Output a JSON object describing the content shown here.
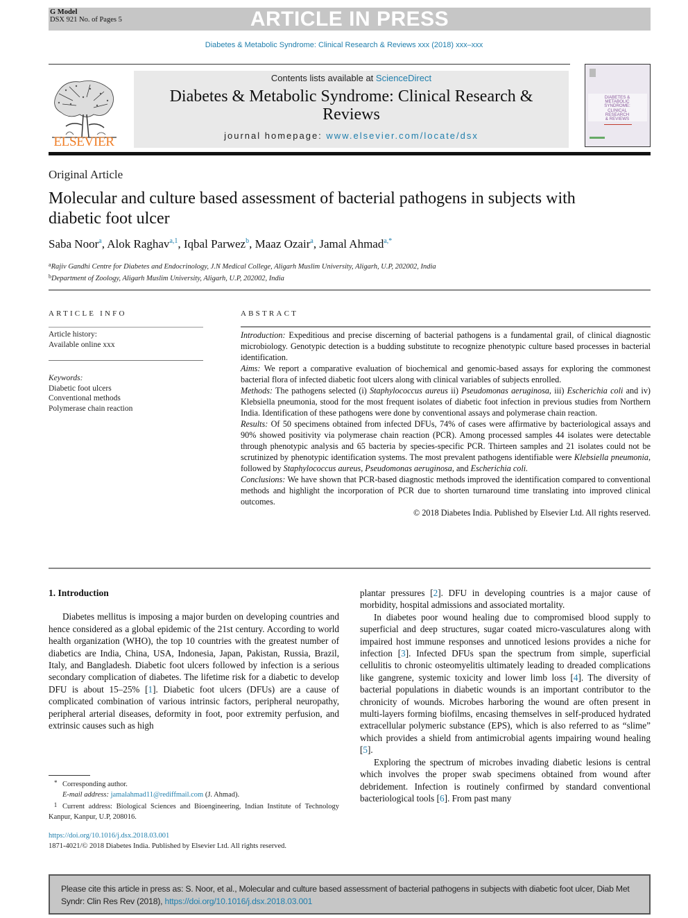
{
  "banner": {
    "gmodel": "G Model",
    "manuscript": "DSX 921 No. of Pages 5",
    "press_label": "ARTICLE IN PRESS"
  },
  "journal_ref": "Diabetes & Metabolic Syndrome: Clinical Research & Reviews xxx (2018) xxx–xxx",
  "header": {
    "publisher": "ELSEVIER",
    "contents_prefix": "Contents lists available at ",
    "contents_link": "ScienceDirect",
    "journal_name": "Diabetes & Metabolic Syndrome: Clinical Research & Reviews",
    "homepage_prefix": "journal homepage: ",
    "homepage_link": "www.elsevier.com/locate/dsx",
    "cover": {
      "lines": [
        "DIABETES &",
        "METABOLIC",
        "SYNDROME:",
        "CLINICAL",
        "RESEARCH",
        "& REVIEWS"
      ],
      "accent_color": "#c0392b",
      "bg_color": "#ece8f0"
    }
  },
  "article": {
    "type": "Original Article",
    "title": "Molecular and culture based assessment of bacterial pathogens in subjects with diabetic foot ulcer",
    "authors": [
      {
        "name": "Saba Noor",
        "sup": "a",
        "sep": ", "
      },
      {
        "name": "Alok Raghav",
        "sup": "a,1",
        "sep": ", "
      },
      {
        "name": "Iqbal Parwez",
        "sup": "b",
        "sep": ", "
      },
      {
        "name": "Maaz Ozair",
        "sup": "a",
        "sep": ", "
      },
      {
        "name": "Jamal Ahmad",
        "sup": "a,*",
        "sep": ""
      }
    ],
    "affiliations": [
      {
        "mark": "a",
        "text": "Rajiv Gandhi Centre for Diabetes and Endocrinology, J.N Medical College, Aligarh Muslim University, Aligarh, U.P, 202002, India"
      },
      {
        "mark": "b",
        "text": "Department of Zoology, Aligarh Muslim University, Aligarh, U.P, 202002, India"
      }
    ]
  },
  "article_info": {
    "heading": "ARTICLE INFO",
    "history_label": "Article history:",
    "history_value": "Available online xxx",
    "keywords_label": "Keywords:",
    "keywords": [
      "Diabetic foot ulcers",
      "Conventional methods",
      "Polymerase chain reaction"
    ]
  },
  "abstract": {
    "heading": "ABSTRACT",
    "introduction_label": "Introduction:",
    "introduction": " Expeditious and precise discerning of bacterial pathogens is a fundamental grail, of clinical diagnostic microbiology. Genotypic detection is a budding substitute to recognize phenotypic culture based processes in bacterial identification.",
    "aims_label": "Aims:",
    "aims": " We report a comparative evaluation of biochemical and genomic-based assays for exploring the commonest bacterial flora of infected diabetic foot ulcers along with clinical variables of subjects enrolled.",
    "methods_label": "Methods:",
    "methods_1": " The pathogens selected (i) ",
    "methods_sp1": "Staphylococcus aureus",
    "methods_2": " ii) ",
    "methods_sp2": "Pseudomonas aeruginosa",
    "methods_3": ", iii) ",
    "methods_sp3": "Escherichia coli",
    "methods_4": " and iv) Klebsiella pneumonia, stood for the most frequent isolates of diabetic foot infection in previous studies from Northern India. Identification of these pathogens were done by conventional assays and polymerase chain reaction.",
    "results_label": "Results:",
    "results_1": " Of 50 specimens obtained from infected DFUs, 74% of cases were affirmative by bacteriological assays and 90% showed positivity via polymerase chain reaction (PCR). Among processed samples 44 isolates were detectable through phenotypic analysis and 65 bacteria by species-specific PCR. Thirteen samples and 21 isolates could not be scrutinized by phenotypic identification systems. The most prevalent pathogens identifiable were ",
    "results_sp1": "Klebsiella pneumonia",
    "results_2": ", followed by ",
    "results_sp2": "Staphylococcus aureus, Pseudomonas aeruginosa,",
    "results_3": " and ",
    "results_sp3": "Escherichia coli.",
    "conclusions_label": "Conclusions:",
    "conclusions": " We have shown that PCR-based diagnostic methods improved the identification compared to conventional methods and highlight the incorporation of PCR due to shorten turnaround time translating into improved clinical outcomes.",
    "copyright": "© 2018 Diabetes India. Published by Elsevier Ltd. All rights reserved."
  },
  "body": {
    "section_title": "1. Introduction",
    "left_p1_a": "Diabetes mellitus is imposing a major burden on developing countries and hence considered as a global epidemic of the 21st century. According to world health organization (WHO), the top 10 countries with the greatest number of diabetics are India, China, USA, Indonesia, Japan, Pakistan, Russia, Brazil, Italy, and Bangladesh. Diabetic foot ulcers followed by infection is a serious secondary complication of diabetes. The lifetime risk for a diabetic to develop DFU is about 15–25% [",
    "ref1": "1",
    "left_p1_b": "]. Diabetic foot ulcers (DFUs) are a cause of complicated combination of various intrinsic factors, peripheral neuropathy, peripheral arterial diseases, deformity in foot, poor extremity perfusion, and extrinsic causes such as high",
    "right_p1_a": "plantar pressures [",
    "ref2": "2",
    "right_p1_b": "]. DFU in developing countries is a major cause of morbidity, hospital admissions and associated mortality.",
    "right_p2_a": "In diabetes poor wound healing due to compromised blood supply to superficial and deep structures, sugar coated micro-vasculatures along with impaired host immune responses and unnoticed lesions provides a niche for infection [",
    "ref3": "3",
    "right_p2_b": "]. Infected DFUs span the spectrum from simple, superficial cellulitis to chronic osteomyelitis ultimately leading to dreaded complications like gangrene, systemic toxicity and lower limb loss [",
    "ref4": "4",
    "right_p2_c": "]. The diversity of bacterial populations in diabetic wounds is an important contributor to the chronicity of wounds. Microbes harboring the wound are often present in multi-layers forming biofilms, encasing themselves in self-produced hydrated extracellular polymeric substance (EPS), which is also referred to as “slime” which provides a shield from antimicrobial agents impairing wound healing [",
    "ref5": "5",
    "right_p2_d": "].",
    "right_p3_a": "Exploring the spectrum of microbes invading diabetic lesions is central which involves the proper swab specimens obtained from wound after debridement. Infection is routinely confirmed by standard conventional bacteriological tools [",
    "ref6": "6",
    "right_p3_b": "]. From past many"
  },
  "footnotes": {
    "corresponding_mark": "*",
    "corresponding": "Corresponding author.",
    "email_label": "E-mail address:",
    "email": "jamalahmad11@rediffmail.com",
    "email_suffix": " (J. Ahmad).",
    "current_mark": "1",
    "current_address": "Current address: Biological Sciences and Bioengineering, Indian Institute of Technology Kanpur, Kanpur, U.P, 208016."
  },
  "doi": {
    "link": "https://doi.org/10.1016/j.dsx.2018.03.001",
    "issn_line": "1871-4021/© 2018 Diabetes India. Published by Elsevier Ltd. All rights reserved."
  },
  "citation": {
    "text": "Please cite this article in press as: S. Noor, et al., Molecular and culture based assessment of bacterial pathogens in subjects with diabetic foot ulcer, Diab Met Syndr: Clin Res Rev (2018), ",
    "link": "https://doi.org/10.1016/j.dsx.2018.03.001"
  },
  "colors": {
    "link": "#1f7eac",
    "elsevier_orange": "#f07e26",
    "banner_gray": "#c6c6c6",
    "journal_box_gray": "#e9e9e9"
  }
}
